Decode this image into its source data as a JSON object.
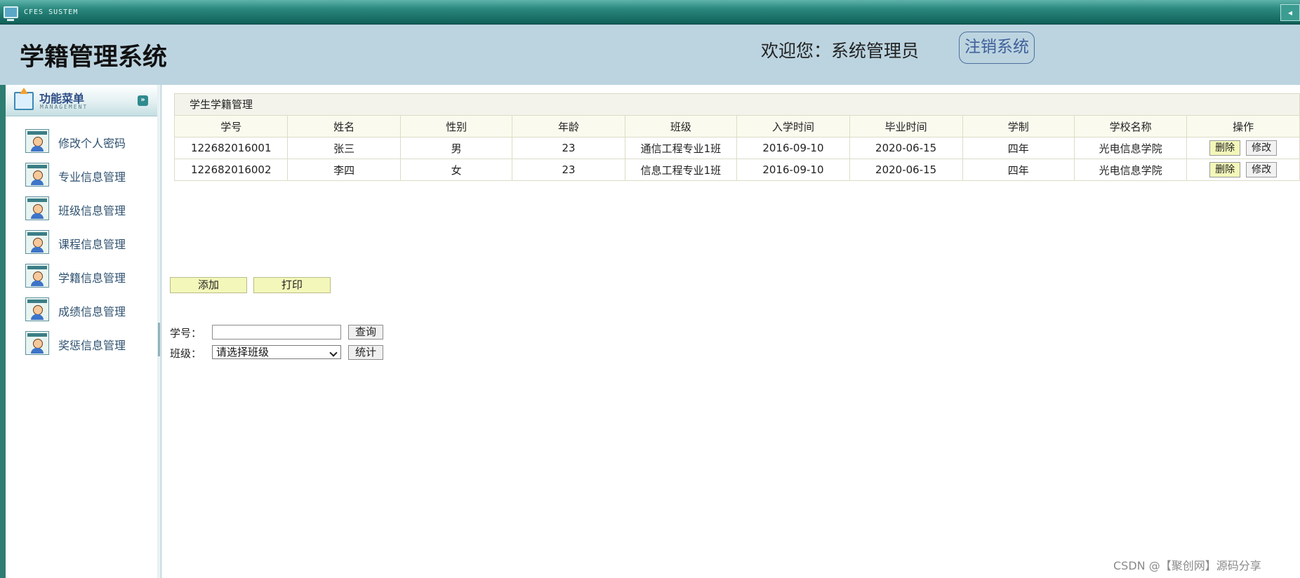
{
  "window": {
    "system_label": "CFES SUSTEM",
    "collapse_icon": "◂"
  },
  "header": {
    "title": "学籍管理系统",
    "welcome": "欢迎您：系统管理员",
    "logout_label": "注销系统"
  },
  "sidebar": {
    "menu_title": "功能菜单",
    "menu_subtitle": "MANAGEMENT",
    "toggle_icon": "»",
    "items": [
      {
        "label": "修改个人密码"
      },
      {
        "label": "专业信息管理"
      },
      {
        "label": "班级信息管理"
      },
      {
        "label": "课程信息管理"
      },
      {
        "label": "学籍信息管理"
      },
      {
        "label": "成绩信息管理"
      },
      {
        "label": "奖惩信息管理"
      }
    ]
  },
  "main": {
    "panel_title": "学生学籍管理",
    "columns": [
      "学号",
      "姓名",
      "性别",
      "年龄",
      "班级",
      "入学时间",
      "毕业时间",
      "学制",
      "学校名称",
      "操作"
    ],
    "rows": [
      [
        "122682016001",
        "张三",
        "男",
        "23",
        "通信工程专业1班",
        "2016-09-10",
        "2020-06-15",
        "四年",
        "光电信息学院"
      ],
      [
        "122682016002",
        "李四",
        "女",
        "23",
        "信息工程专业1班",
        "2016-09-10",
        "2020-06-15",
        "四年",
        "光电信息学院"
      ]
    ],
    "delete_label": "删除",
    "edit_label": "修改",
    "add_label": "添加",
    "print_label": "打印",
    "search": {
      "id_label": "学号：",
      "id_value": "",
      "query_label": "查询",
      "class_label": "班级：",
      "class_selected": "请选择班级",
      "stat_label": "统计"
    }
  },
  "watermark": "CSDN @【聚创网】源码分享"
}
